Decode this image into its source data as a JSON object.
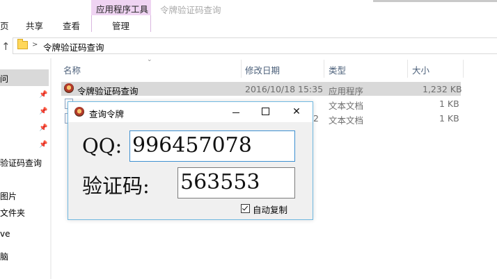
{
  "ribbon": {
    "context_group": "应用程序工具",
    "window_title": "令牌验证码查询",
    "tabs": [
      "页",
      "共享",
      "查看",
      "管理"
    ]
  },
  "address": {
    "path": "令牌验证码查询"
  },
  "nav": {
    "items": [
      "问",
      "验证码查询",
      "图片",
      "文件夹",
      "ve",
      "脑"
    ]
  },
  "list": {
    "columns": [
      "名称",
      "修改日期",
      "类型",
      "大小"
    ],
    "rows": [
      {
        "name": "令牌验证码查询",
        "date": "2016/10/18 15:35",
        "type": "应用程序",
        "size": "1,232 KB"
      },
      {
        "name": "",
        "date": "",
        "type": "文本文档",
        "size": "1 KB"
      },
      {
        "name": "",
        "date": "2",
        "type": "文本文档",
        "size": "1 KB"
      }
    ]
  },
  "dialog": {
    "title": "查询令牌",
    "qq_label": "QQ:",
    "qq_value": "996457078",
    "code_label": "验证码:",
    "code_value": "563553",
    "auto_copy_label": "自动复制",
    "auto_copy_checked": true,
    "close_glyph": "✕"
  },
  "colors": {
    "context_tab": "#efd4f2",
    "selection": "#d9d9d9",
    "dialog_border": "#6fb8e0",
    "active_field_border": "#3c8fd0"
  }
}
